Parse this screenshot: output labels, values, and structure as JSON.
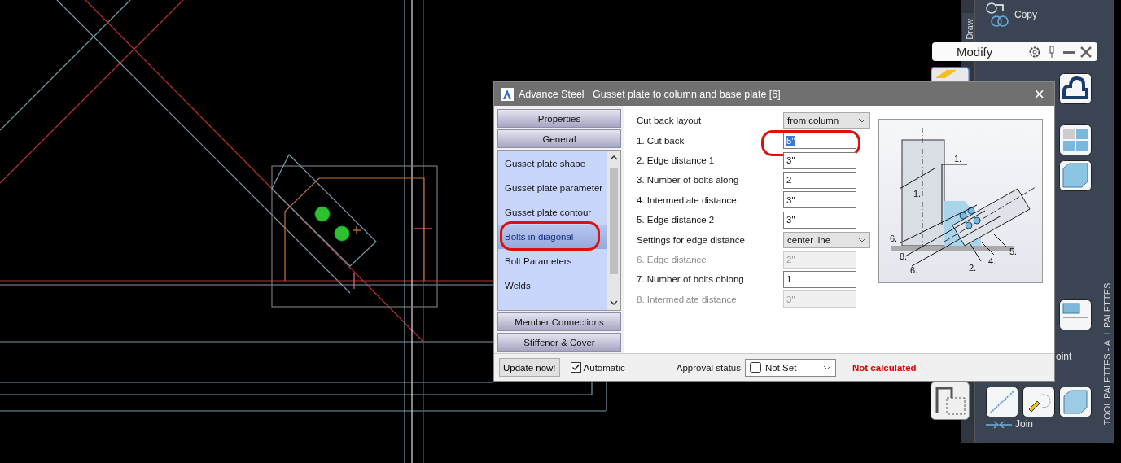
{
  "dialog": {
    "app": "Advance Steel",
    "title": "Gusset plate to column and base plate [6]",
    "close": "×",
    "nav_top": [
      {
        "label": "Properties"
      },
      {
        "label": "General"
      }
    ],
    "nav_items": [
      {
        "label": "Gusset plate shape",
        "selected": false,
        "annotated": false
      },
      {
        "label": "Gusset plate parameter",
        "selected": false,
        "annotated": false
      },
      {
        "label": "Gusset plate contour",
        "selected": false,
        "annotated": false
      },
      {
        "label": "Bolts in diagonal",
        "selected": true,
        "annotated": true
      },
      {
        "label": "Bolt Parameters",
        "selected": false,
        "annotated": false
      },
      {
        "label": "Welds",
        "selected": false,
        "annotated": false
      }
    ],
    "nav_bottom": [
      {
        "label": "Member Connections"
      },
      {
        "label": "Stiffener & Cover"
      }
    ],
    "fields": [
      {
        "kind": "select",
        "label": "Cut back layout",
        "value": "from column",
        "disabled": false,
        "annotated": false
      },
      {
        "kind": "input",
        "label": "1. Cut back",
        "value": "5\"",
        "disabled": false,
        "annotated": true,
        "text_selected": true
      },
      {
        "kind": "input",
        "label": "2. Edge distance 1",
        "value": "3\"",
        "disabled": false,
        "annotated": false
      },
      {
        "kind": "input",
        "label": "3. Number of bolts along",
        "value": "2",
        "disabled": false,
        "annotated": false
      },
      {
        "kind": "input",
        "label": "4. Intermediate distance",
        "value": "3\"",
        "disabled": false,
        "annotated": false
      },
      {
        "kind": "input",
        "label": "5. Edge distance 2",
        "value": "3\"",
        "disabled": false,
        "annotated": false
      },
      {
        "kind": "select",
        "label": "Settings for edge distance",
        "value": "center line",
        "disabled": false,
        "annotated": false
      },
      {
        "kind": "input",
        "label": "6. Edge distance",
        "value": "2\"",
        "disabled": true,
        "annotated": false
      },
      {
        "kind": "input",
        "label": "7. Number of bolts oblong",
        "value": "1",
        "disabled": false,
        "annotated": false
      },
      {
        "kind": "input",
        "label": "8. Intermediate distance",
        "value": "3\"",
        "disabled": true,
        "annotated": false
      }
    ],
    "diagram_labels": [
      "1.",
      "1.",
      "6.",
      "8.",
      "6.",
      "2.",
      "4.",
      "5."
    ],
    "update_button": "Update now!",
    "automatic": {
      "label": "Automatic",
      "checked": true
    },
    "approval": {
      "label": "Approval status",
      "value": "Not Set"
    },
    "status": "Not calculated"
  },
  "palette": {
    "tab": "Draw",
    "header": "Modify",
    "copy_label": "Copy",
    "point_label": "oint",
    "join_label": "Join",
    "title": "TOOL PALETTES - ALL PALETTES"
  }
}
